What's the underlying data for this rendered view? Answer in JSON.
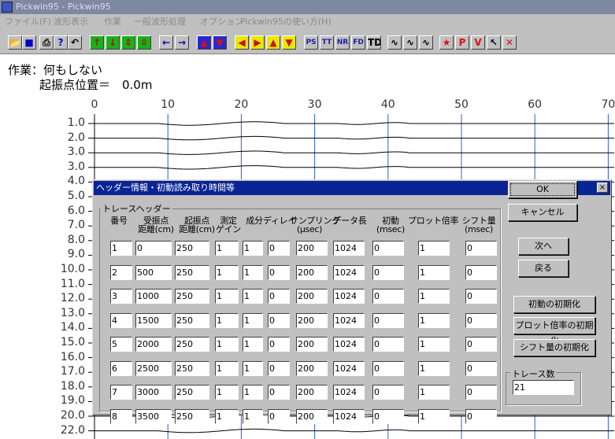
{
  "window": {
    "title": "Pickwin95 - Pickwin95"
  },
  "menu": [
    "ファイル(F)",
    "波形表示",
    "作業",
    "一般波形処理",
    "オプション",
    "Pickwin95の使い方(H)"
  ],
  "toolbar": [
    {
      "name": "open-file-button",
      "glyph": "📂",
      "cls": ""
    },
    {
      "name": "save-button",
      "glyph": "■",
      "cls": "bl"
    },
    {
      "name": "print-button",
      "glyph": "⎙",
      "cls": ""
    },
    {
      "name": "help-button",
      "glyph": "?",
      "cls": "bl"
    },
    {
      "name": "undo-button",
      "glyph": "↶",
      "cls": ""
    },
    {
      "name": "amp-up-button",
      "glyph": "↑",
      "cls": "g"
    },
    {
      "name": "amp-down-button",
      "glyph": "↓",
      "cls": "g"
    },
    {
      "name": "expand-vertical-button",
      "glyph": "⇕",
      "cls": "g"
    },
    {
      "name": "shrink-vertical-button",
      "glyph": "⇳",
      "cls": "g"
    },
    {
      "name": "scroll-left-button",
      "glyph": "←",
      "cls": "bl"
    },
    {
      "name": "scroll-right-button",
      "glyph": "→",
      "cls": "bl"
    },
    {
      "name": "trace-up-button",
      "glyph": "▲",
      "cls": "b"
    },
    {
      "name": "trace-down-button",
      "glyph": "▼",
      "cls": "b"
    },
    {
      "name": "left-arrow-button",
      "glyph": "◀",
      "cls": "y"
    },
    {
      "name": "right-arrow-button",
      "glyph": "▶",
      "cls": "y"
    },
    {
      "name": "up-arrow-button",
      "glyph": "▲",
      "cls": "y"
    },
    {
      "name": "down-arrow-button",
      "glyph": "▼",
      "cls": "y"
    },
    {
      "name": "ps-button",
      "glyph": "PS",
      "cls": "gb"
    },
    {
      "name": "tt-button",
      "glyph": "TT",
      "cls": "gb"
    },
    {
      "name": "nr-button",
      "glyph": "NR",
      "cls": "gb"
    },
    {
      "name": "fd-button",
      "glyph": "FD",
      "cls": "gb"
    },
    {
      "name": "td-button",
      "glyph": "TD",
      "cls": ""
    },
    {
      "name": "wave-display-button",
      "glyph": "∿",
      "cls": ""
    },
    {
      "name": "wave-fill-button",
      "glyph": "∿",
      "cls": ""
    },
    {
      "name": "wave-variable-button",
      "glyph": "∿",
      "cls": ""
    },
    {
      "name": "pick-star-button",
      "glyph": "★",
      "cls": "r"
    },
    {
      "name": "p-button",
      "glyph": "P",
      "cls": "r"
    },
    {
      "name": "v-button",
      "glyph": "V",
      "cls": "r"
    },
    {
      "name": "pointer-button",
      "glyph": "↖",
      "cls": ""
    },
    {
      "name": "close-x-button",
      "glyph": "✕",
      "cls": "r"
    }
  ],
  "status": {
    "task": "作業：何もしない",
    "shot_position": "起振点位置＝　0.0m"
  },
  "axis": {
    "x_ticks": [
      "0",
      "10",
      "20",
      "30",
      "40",
      "50",
      "60",
      "70"
    ],
    "y_ticks": [
      "1.0",
      "2.0",
      "3.0",
      "3.0",
      "4.0",
      "5.0",
      "6.0",
      "7.0",
      "8.0",
      "9.0",
      "10.0",
      "11.0",
      "12.0",
      "13.0",
      "14.0",
      "15.0",
      "16.0",
      "17.0",
      "18.0",
      "19.0",
      "20.0",
      "22.0"
    ]
  },
  "dialog": {
    "title": "ヘッダー情報・初動読み取り時間等",
    "group_label": "トレースヘッダー",
    "headers": [
      "番号",
      "受振点\n距離(cm)",
      "起振点\n距離(cm)",
      "測定\nゲイン",
      "成分",
      "ディレイ",
      "サンプリング\n(μsec)",
      "データ長",
      "初動\n(msec)",
      "プロット倍率",
      "シフト量\n(msec)"
    ],
    "rows": [
      [
        "1",
        "0",
        "250",
        "1",
        "1",
        "0",
        "200",
        "1024",
        "0",
        "1",
        "0"
      ],
      [
        "2",
        "500",
        "250",
        "1",
        "1",
        "0",
        "200",
        "1024",
        "0",
        "1",
        "0"
      ],
      [
        "3",
        "1000",
        "250",
        "1",
        "1",
        "0",
        "200",
        "1024",
        "0",
        "1",
        "0"
      ],
      [
        "4",
        "1500",
        "250",
        "1",
        "1",
        "0",
        "200",
        "1024",
        "0",
        "1",
        "0"
      ],
      [
        "5",
        "2000",
        "250",
        "1",
        "1",
        "0",
        "200",
        "1024",
        "0",
        "1",
        "0"
      ],
      [
        "6",
        "2500",
        "250",
        "1",
        "1",
        "0",
        "200",
        "1024",
        "0",
        "1",
        "0"
      ],
      [
        "7",
        "3000",
        "250",
        "1",
        "1",
        "0",
        "200",
        "1024",
        "0",
        "1",
        "0"
      ],
      [
        "8",
        "3500",
        "250",
        "1",
        "1",
        "0",
        "200",
        "1024",
        "0",
        "1",
        "0"
      ]
    ],
    "buttons": {
      "ok": "OK",
      "cancel": "キャンセル",
      "next": "次へ",
      "back": "戻る",
      "init_first": "初動の初期化",
      "init_plot": "プロット倍率の初期化",
      "init_shift": "シフト量の初期化"
    },
    "trace_count_label": "トレース数",
    "trace_count": "21",
    "close_glyph": "×"
  }
}
